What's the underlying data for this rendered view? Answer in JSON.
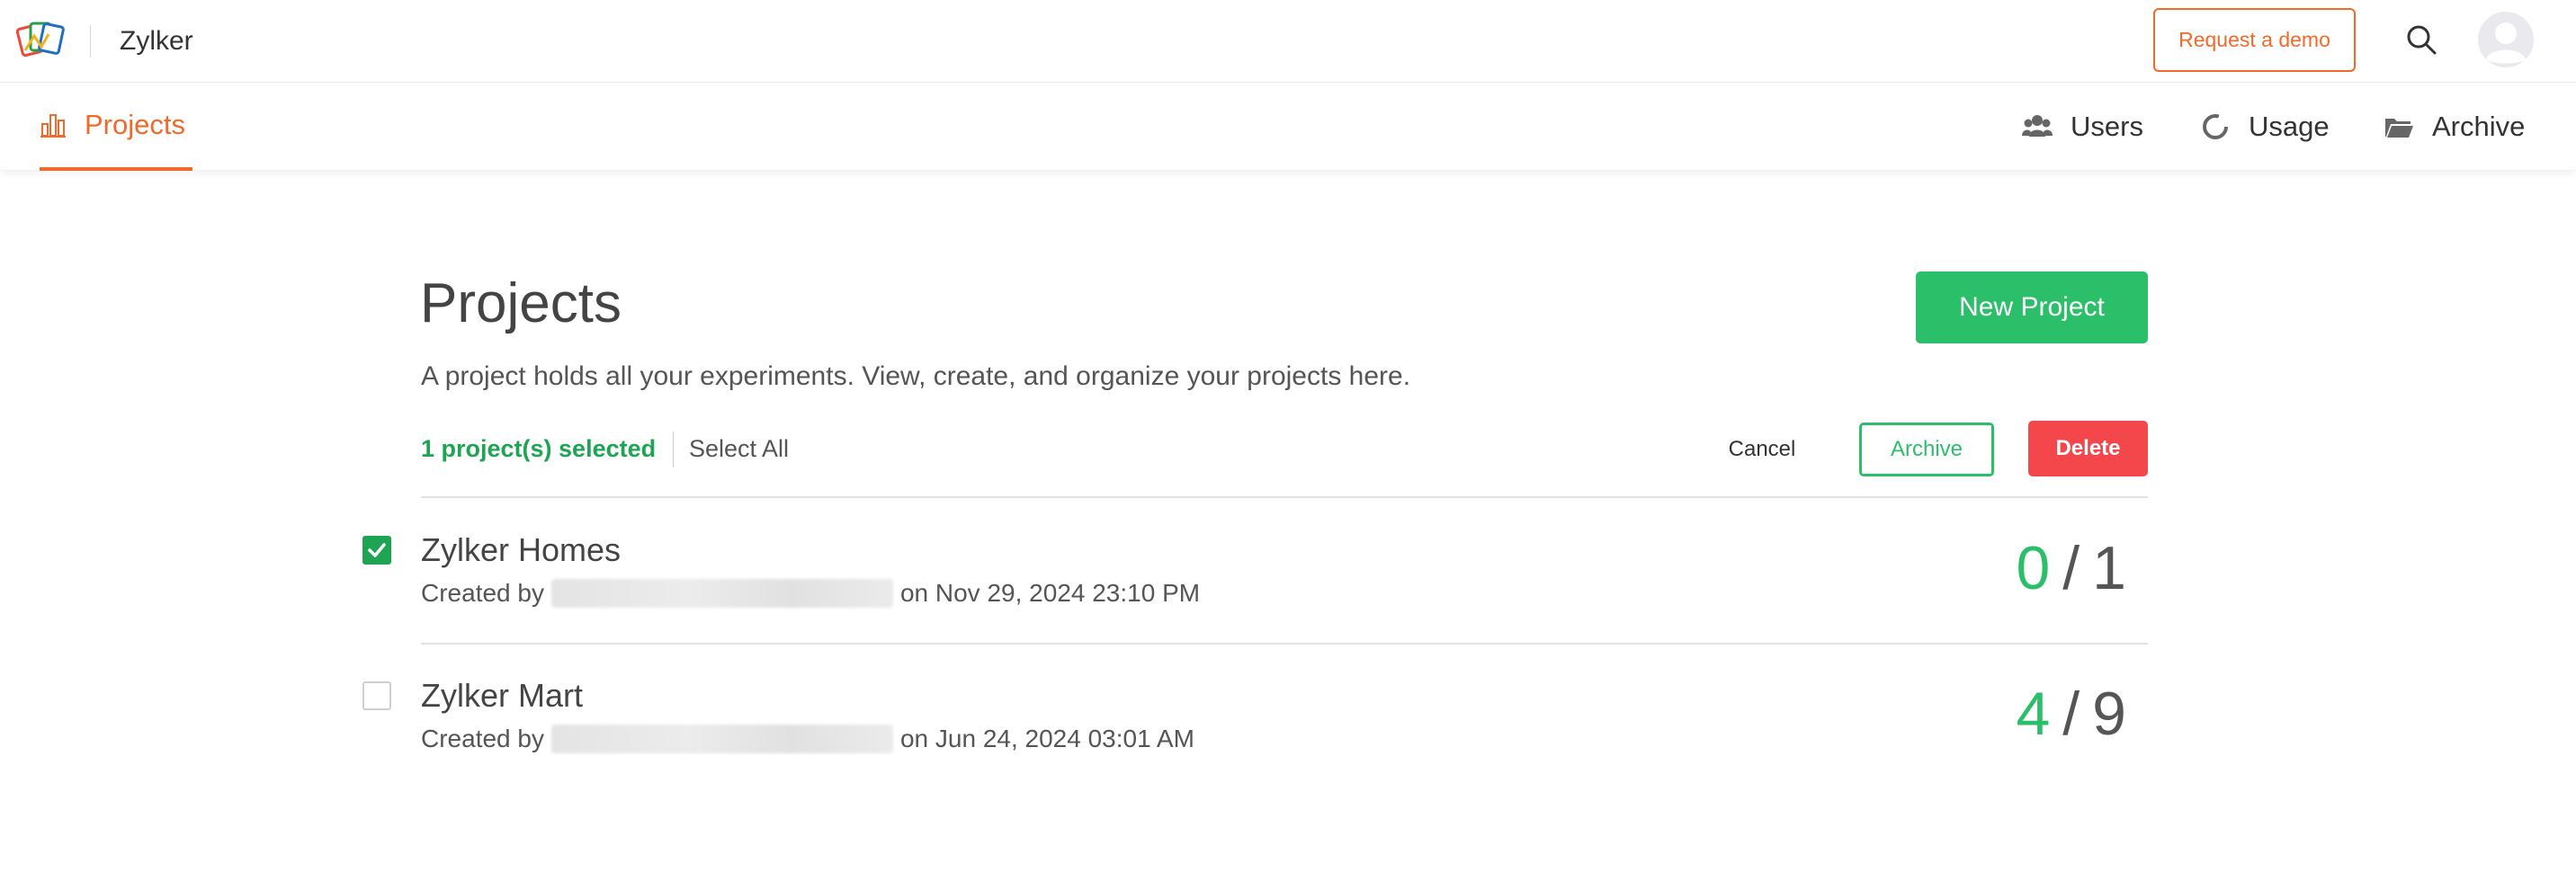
{
  "header": {
    "app_title": "Zylker",
    "request_demo_label": "Request a demo",
    "logo_icon": "zylker-cards-logo",
    "search_icon": "search-icon",
    "avatar_icon": "avatar"
  },
  "nav": {
    "active_tab": {
      "label": "Projects",
      "icon": "projects-icon"
    },
    "right_items": [
      {
        "label": "Users",
        "icon": "users-icon"
      },
      {
        "label": "Usage",
        "icon": "usage-icon"
      },
      {
        "label": "Archive",
        "icon": "folder-icon"
      }
    ]
  },
  "main": {
    "title": "Projects",
    "description": "A project holds all your experiments. View, create, and organize your projects here.",
    "new_project_label": "New Project"
  },
  "selection_bar": {
    "count_label": "1 project(s) selected",
    "select_all_label": "Select All",
    "cancel_label": "Cancel",
    "archive_label": "Archive",
    "delete_label": "Delete"
  },
  "projects": [
    {
      "name": "Zylker Homes",
      "created_by_prefix": "Created by",
      "created_on": "on Nov 29, 2024 23:10 PM",
      "completed": "0",
      "separator": "/",
      "total": "1",
      "selected": true
    },
    {
      "name": "Zylker Mart",
      "created_by_prefix": "Created by",
      "created_on": "on Jun 24, 2024 03:01 AM",
      "completed": "4",
      "separator": "/",
      "total": "9",
      "selected": false
    }
  ],
  "colors": {
    "accent_orange": "#f26a2a",
    "primary_green": "#2bbf6a",
    "selected_green": "#1fa454",
    "danger_red": "#f4474c"
  }
}
